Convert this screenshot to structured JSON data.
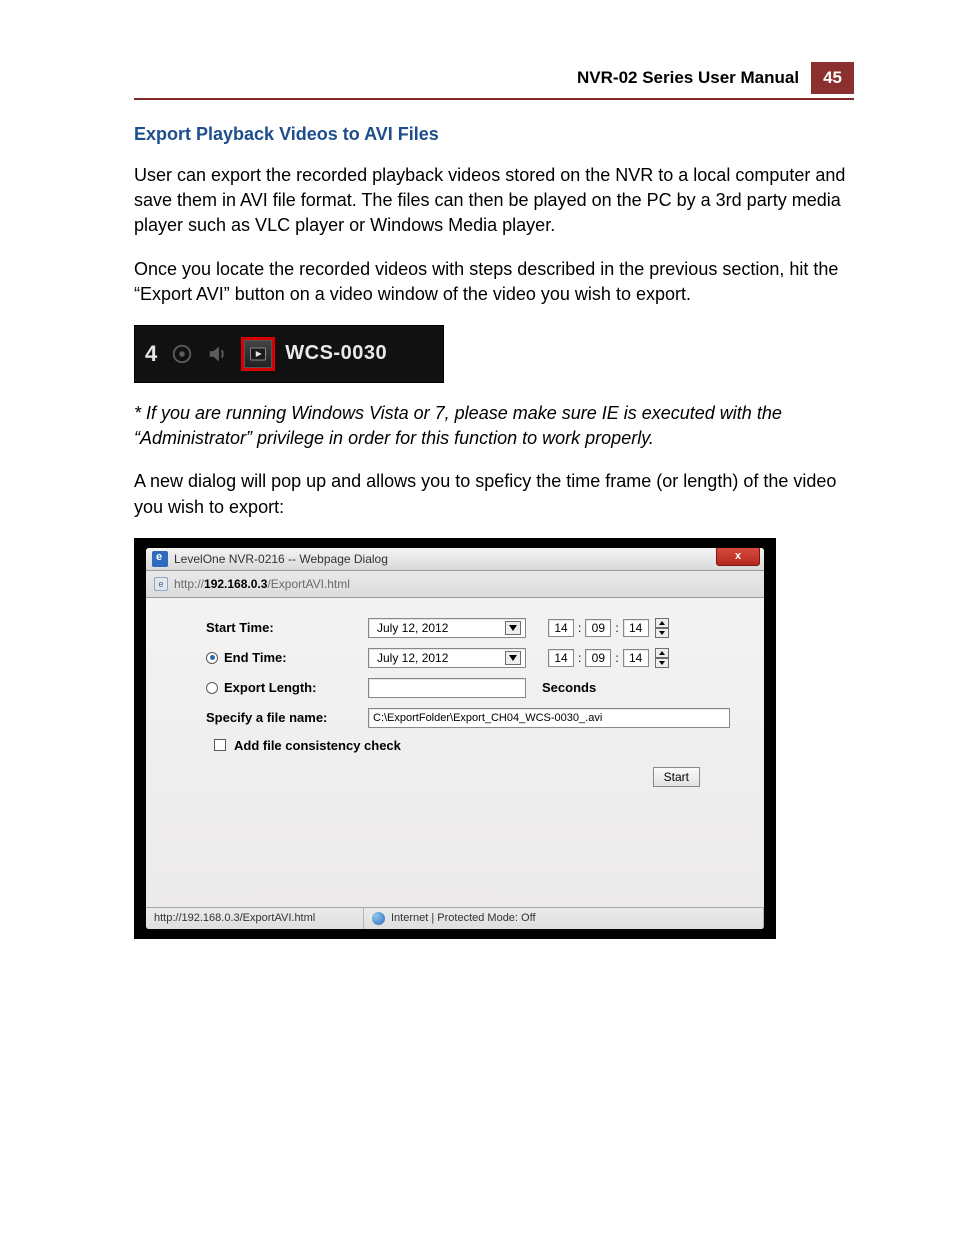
{
  "header": {
    "title": "NVR-02 Series User Manual",
    "page": "45"
  },
  "section": {
    "title": "Export Playback Videos to AVI Files"
  },
  "para1": "User can export the recorded playback videos stored on the NVR to a local computer and save them in AVI file format. The files can then be played on the PC by a 3rd party media player such as VLC player or Windows Media player.",
  "para2": "Once you locate the recorded videos with steps described in the previous section, hit the “Export AVI” button on a video window of the video you wish to export.",
  "toolbar": {
    "channel": "4",
    "camera_label": "WCS-0030"
  },
  "note": "* If you are running Windows Vista or 7, please make sure IE is executed with the “Administrator” privilege in order for this function to work properly.",
  "para3": "A new dialog will pop up and allows you to speficy the time frame (or length) of the video you wish to export:",
  "dialog": {
    "title": "LevelOne NVR-0216 -- Webpage Dialog",
    "url_prefix": "http://",
    "url_host": "192.168.0.3",
    "url_suffix": "/ExportAVI.html",
    "close_symbol": "x",
    "labels": {
      "start_time": "Start Time:",
      "end_time": "End Time:",
      "export_length": "Export Length:",
      "seconds": "Seconds",
      "specify_file": "Specify a file name:",
      "consistency": "Add file consistency check",
      "start": "Start"
    },
    "start": {
      "date": "July 12, 2012",
      "h": "14",
      "m": "09",
      "s": "14"
    },
    "end": {
      "date": "July 12, 2012",
      "h": "14",
      "m": "09",
      "s": "14"
    },
    "filename": "C:\\ExportFolder\\Export_CH04_WCS-0030_.avi",
    "status_url": "http://192.168.0.3/ExportAVI.html",
    "status_zone": "Internet | Protected Mode: Off"
  }
}
